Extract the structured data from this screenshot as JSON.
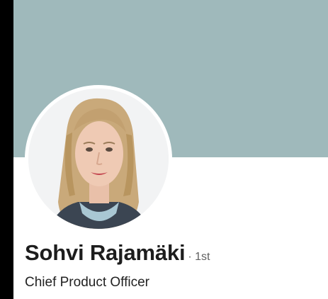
{
  "profile": {
    "name": "Sohvi Rajamäki",
    "degree": "· 1st",
    "headline": "Chief Product Officer"
  },
  "colors": {
    "banner": "#9fb9bb",
    "name_text": "#1d1d1d",
    "secondary_text": "#5f5f5f",
    "outside_frame": "#000000"
  },
  "icons": {
    "avatar": "profile-photo"
  }
}
